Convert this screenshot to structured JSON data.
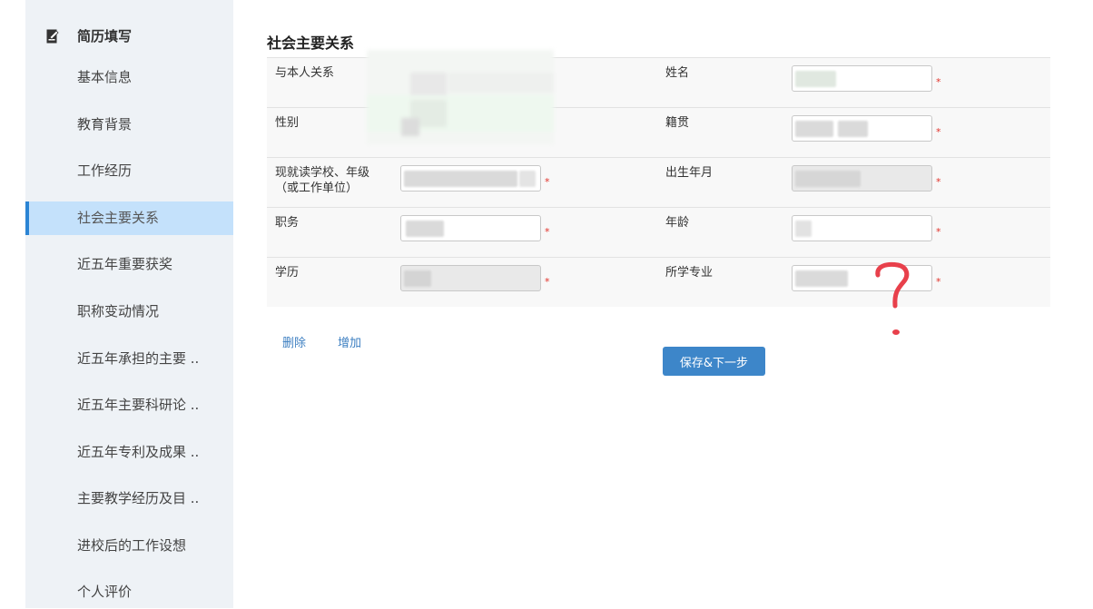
{
  "sidebar": {
    "header": "简历填写",
    "items": [
      {
        "label": "基本信息"
      },
      {
        "label": "教育背景"
      },
      {
        "label": "工作经历"
      },
      {
        "label": "社会主要关系"
      },
      {
        "label": "近五年重要获奖"
      },
      {
        "label": "职称变动情况"
      },
      {
        "label": "近五年承担的主要 .."
      },
      {
        "label": "近五年主要科研论 .."
      },
      {
        "label": "近五年专利及成果 .."
      },
      {
        "label": "主要教学经历及目 .."
      },
      {
        "label": "进校后的工作设想"
      },
      {
        "label": "个人评价"
      }
    ],
    "active_index": 3
  },
  "main": {
    "section_title": "社会主要关系",
    "fields": {
      "relation": "与本人关系",
      "name": "姓名",
      "gender": "性别",
      "native_place": "籍贯",
      "school_line1": "现就读学校、年级",
      "school_line2": "（或工作单位）",
      "birth": "出生年月",
      "position": "职务",
      "age": "年龄",
      "education": "学历",
      "major": "所学专业"
    },
    "required_mark": "*",
    "actions": {
      "delete": "删除",
      "add": "增加",
      "save_next": "保存&下一步"
    }
  },
  "colors": {
    "accent": "#3d86c9",
    "active_bg": "#c4e1fb",
    "required": "#e2332b",
    "annotation": "#e8404b"
  }
}
